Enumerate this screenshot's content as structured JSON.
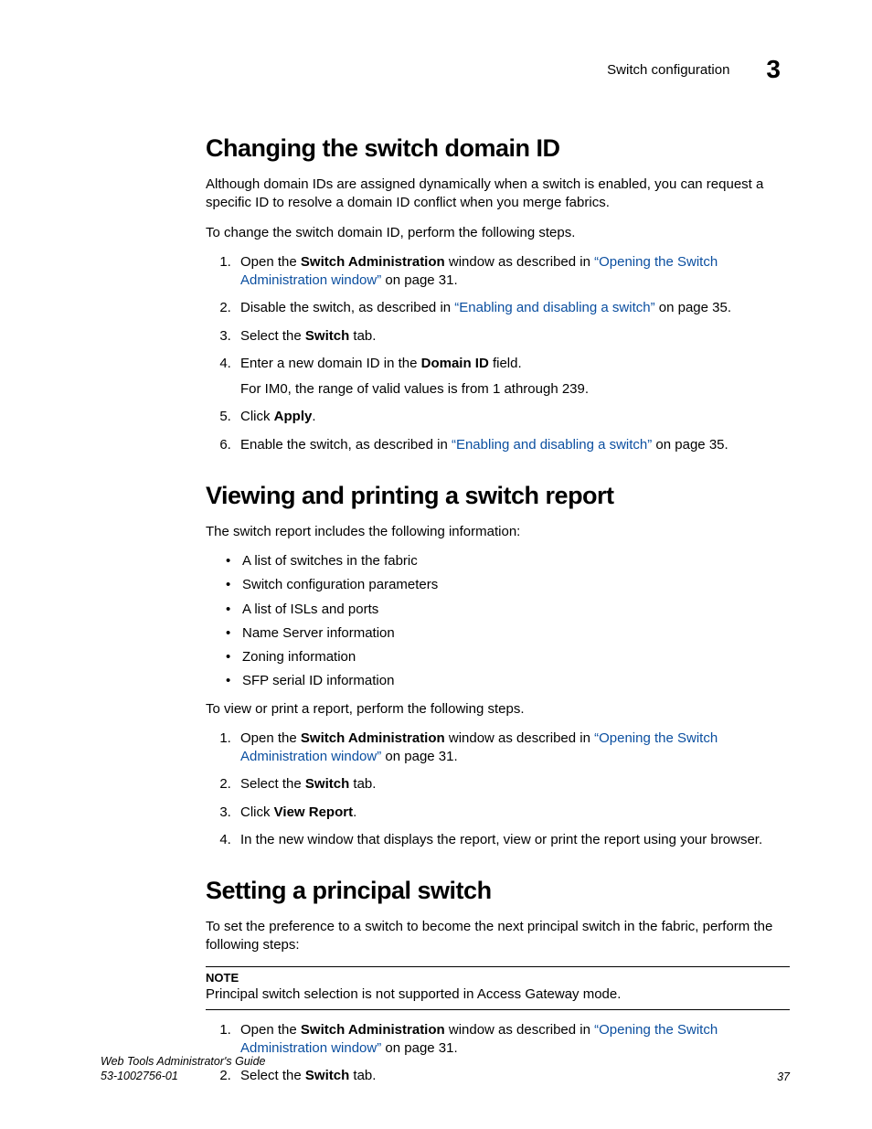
{
  "header": {
    "section_title": "Switch configuration",
    "chapter_number": "3"
  },
  "section1": {
    "heading": "Changing the switch domain ID",
    "para1": "Although domain IDs are assigned dynamically when a switch is enabled, you can request a specific ID to resolve a domain ID conflict when you merge fabrics.",
    "para2": "To change the switch domain ID, perform the following steps.",
    "steps": {
      "s1_a": "Open the ",
      "s1_bold": "Switch Administration",
      "s1_b": " window as described in ",
      "s1_link": "“Opening the Switch Administration window”",
      "s1_c": " on page 31.",
      "s2_a": "Disable the switch, as described in ",
      "s2_link": "“Enabling and disabling a switch”",
      "s2_b": " on page 35.",
      "s3_a": "Select the ",
      "s3_bold": "Switch",
      "s3_b": " tab.",
      "s4_a": "Enter a new domain ID in the ",
      "s4_bold": "Domain ID",
      "s4_b": " field.",
      "s4_sub": "For IM0, the range of valid values is from 1 athrough 239.",
      "s5_a": "Click ",
      "s5_bold": "Apply",
      "s5_b": ".",
      "s6_a": "Enable the switch, as described in ",
      "s6_link": "“Enabling and disabling a switch”",
      "s6_b": " on page 35."
    }
  },
  "section2": {
    "heading": "Viewing and printing a switch report",
    "para1": "The switch report includes the following information:",
    "bullets": [
      "A list of switches in the fabric",
      "Switch configuration parameters",
      "A list of ISLs and ports",
      "Name Server information",
      "Zoning information",
      "SFP serial ID information"
    ],
    "para2": "To view or print a report, perform the following steps.",
    "steps": {
      "s1_a": "Open the ",
      "s1_bold": "Switch Administration",
      "s1_b": " window as described in ",
      "s1_link": "“Opening the Switch Administration window”",
      "s1_c": " on page 31.",
      "s2_a": "Select the ",
      "s2_bold": "Switch",
      "s2_b": " tab.",
      "s3_a": "Click ",
      "s3_bold": "View Report",
      "s3_b": ".",
      "s4": "In the new window that displays the report, view or print the report using your browser."
    }
  },
  "section3": {
    "heading": "Setting a principal switch",
    "para1": "To set the preference to a switch to become the next principal switch in the fabric, perform the following steps:",
    "note_title": "NOTE",
    "note_text": "Principal switch selection is not supported in Access Gateway mode.",
    "steps": {
      "s1_a": "Open the ",
      "s1_bold": "Switch Administration",
      "s1_b": " window as described in ",
      "s1_link": "“Opening the Switch Administration window”",
      "s1_c": " on page 31.",
      "s2_a": "Select the ",
      "s2_bold": "Switch",
      "s2_b": " tab."
    }
  },
  "footer": {
    "guide_title": "Web Tools Administrator's Guide",
    "doc_number": "53-1002756-01",
    "page_number": "37"
  }
}
